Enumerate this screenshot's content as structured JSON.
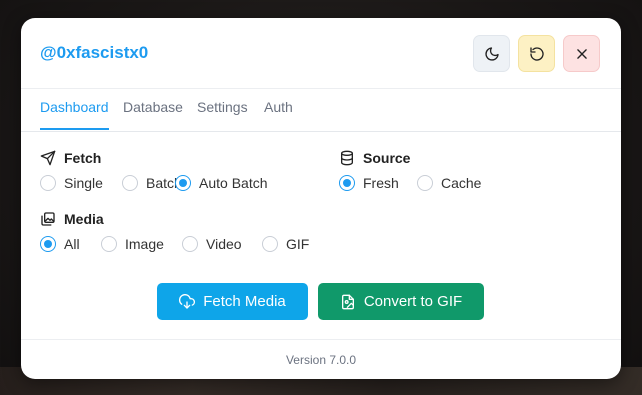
{
  "header": {
    "username": "@0xfascistx0",
    "theme_icon": "moon-icon",
    "reset_icon": "refresh-icon",
    "close_icon": "close-icon"
  },
  "tabs": [
    {
      "label": "Dashboard",
      "active": true
    },
    {
      "label": "Database",
      "active": false
    },
    {
      "label": "Settings",
      "active": false
    },
    {
      "label": "Auth",
      "active": false
    }
  ],
  "fetch": {
    "title": "Fetch",
    "icon": "send-icon",
    "options": [
      {
        "label": "Single",
        "checked": false
      },
      {
        "label": "Batch",
        "checked": false
      },
      {
        "label": "Auto Batch",
        "checked": true
      }
    ]
  },
  "source": {
    "title": "Source",
    "icon": "database-icon",
    "options": [
      {
        "label": "Fresh",
        "checked": true
      },
      {
        "label": "Cache",
        "checked": false
      }
    ]
  },
  "media": {
    "title": "Media",
    "icon": "images-icon",
    "options": [
      {
        "label": "All",
        "checked": true
      },
      {
        "label": "Image",
        "checked": false
      },
      {
        "label": "Video",
        "checked": false
      },
      {
        "label": "GIF",
        "checked": false
      }
    ]
  },
  "actions": {
    "fetch_label": "Fetch Media",
    "fetch_icon": "cloud-download-icon",
    "gif_label": "Convert to GIF",
    "gif_icon": "image-file-icon"
  },
  "footer": {
    "version": "Version 7.0.0"
  },
  "colors": {
    "accent": "#1d9bf0",
    "fetch_button": "#0ea5e9",
    "gif_button": "#10996a"
  }
}
